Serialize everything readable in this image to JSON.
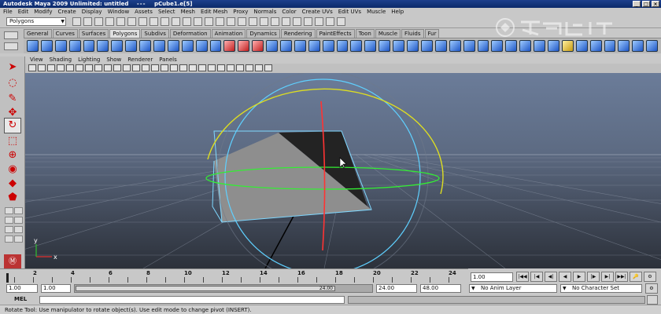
{
  "window": {
    "title_app": "Autodesk Maya 2009 Unlimited: untitled",
    "title_sep": "---",
    "title_object": "pCube1.e[5]",
    "controls": [
      "_",
      "□",
      "×"
    ]
  },
  "menu": [
    "File",
    "Edit",
    "Modify",
    "Create",
    "Display",
    "Window",
    "Assets",
    "Select",
    "Mesh",
    "Edit Mesh",
    "Proxy",
    "Normals",
    "Color",
    "Create UVs",
    "Edit UVs",
    "Muscle",
    "Help"
  ],
  "status": {
    "mode": "Polygons"
  },
  "shelf_tabs": [
    {
      "label": "General",
      "active": false
    },
    {
      "label": "Curves",
      "active": false
    },
    {
      "label": "Surfaces",
      "active": false
    },
    {
      "label": "Polygons",
      "active": true
    },
    {
      "label": "Subdivs",
      "active": false
    },
    {
      "label": "Deformation",
      "active": false
    },
    {
      "label": "Animation",
      "active": false
    },
    {
      "label": "Dynamics",
      "active": false
    },
    {
      "label": "Rendering",
      "active": false
    },
    {
      "label": "PaintEffects",
      "active": false
    },
    {
      "label": "Toon",
      "active": false
    },
    {
      "label": "Muscle",
      "active": false
    },
    {
      "label": "Fluids",
      "active": false
    },
    {
      "label": "Fur",
      "active": false
    }
  ],
  "panel_menu": [
    "View",
    "Shading",
    "Lighting",
    "Show",
    "Renderer",
    "Panels"
  ],
  "viewport": {
    "axis_x": "x",
    "axis_y": "y",
    "colors": {
      "ring_x": "#ff3333",
      "ring_y": "#dddd22",
      "ring_z": "#33ee33",
      "outer_ring": "#5fd0ff",
      "face_light": "#8e8e8e",
      "face_dark": "#232323"
    }
  },
  "time_slider": {
    "tick_labels": [
      "2",
      "4",
      "6",
      "8",
      "10",
      "12",
      "14",
      "16",
      "18",
      "20",
      "22",
      "24"
    ],
    "current_frame": "1.00"
  },
  "range": {
    "start": "1.00",
    "inner_start": "1.00",
    "slider_value": "24.00",
    "end": "24.00",
    "outer_end": "48.00",
    "anim_layer": "No Anim Layer",
    "character_set": "No Character Set"
  },
  "command_line": {
    "label": "MEL"
  },
  "help_line": "Rotate Tool: Use manipulator to rotate object(s). Use edit mode to change pivot (INSERT)."
}
